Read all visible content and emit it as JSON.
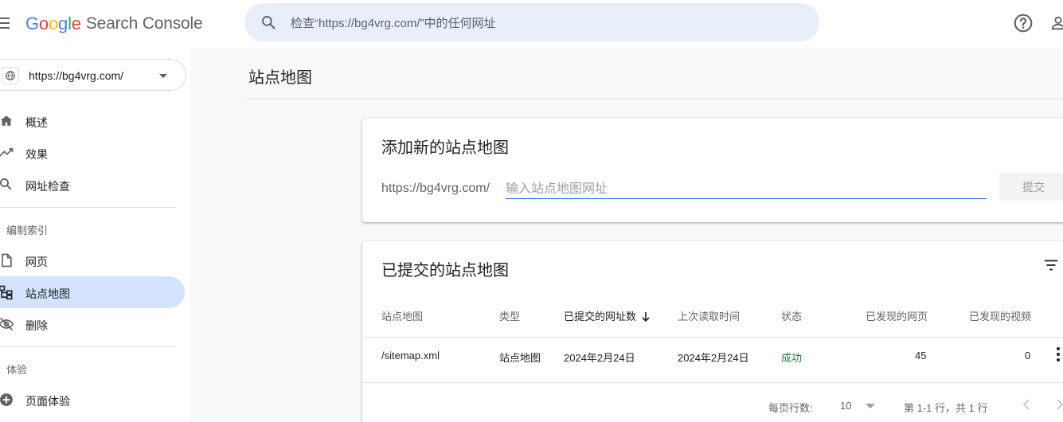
{
  "header": {
    "logo": {
      "g1": "G",
      "o1": "o",
      "o2": "o",
      "g2": "g",
      "l": "l",
      "e": "e",
      "product": "Search Console"
    },
    "search_placeholder": "检查“https://bg4vrg.com/”中的任何网址",
    "icons": {
      "menu": "menu-icon",
      "search": "search-icon",
      "help": "help-circle-icon",
      "account": "account-icon"
    }
  },
  "sidebar": {
    "property": "https://bg4vrg.com/",
    "nav_top": [
      {
        "label": "概述",
        "icon": "home-icon"
      },
      {
        "label": "效果",
        "icon": "trending-icon"
      },
      {
        "label": "网址检查",
        "icon": "search-icon"
      }
    ],
    "section_index": "编制索引",
    "nav_index": [
      {
        "label": "网页",
        "icon": "page-icon"
      },
      {
        "label": "站点地图",
        "icon": "sitemap-icon",
        "active": true
      },
      {
        "label": "删除",
        "icon": "visibility-off-icon"
      }
    ],
    "section_experience": "体验",
    "nav_experience": [
      {
        "label": "页面体验",
        "icon": "add-circle-icon"
      }
    ]
  },
  "main": {
    "page_title": "站点地图",
    "add_card": {
      "title": "添加新的站点地图",
      "url_prefix": "https://bg4vrg.com/",
      "input_placeholder": "输入站点地图网址",
      "submit_label": "提交"
    },
    "list_card": {
      "title": "已提交的站点地图",
      "columns": [
        "站点地图",
        "类型",
        "已提交的网址数",
        "上次读取时间",
        "状态",
        "已发现的网页",
        "已发现的视频"
      ],
      "rows": [
        {
          "sitemap": "/sitemap.xml",
          "type": "站点地图",
          "submitted": "2024年2月24日",
          "last_read": "2024年2月24日",
          "status": "成功",
          "pages": "45",
          "videos": "0"
        }
      ],
      "pager": {
        "rows_per_page_label": "每页行数:",
        "rows_per_page": "10",
        "range": "第 1-1 行，共 1 行"
      }
    }
  },
  "colors": {
    "accent": "#1a73e8",
    "active_nav": "#d3e3fd",
    "success": "#188038",
    "search_bg": "#e8eefa"
  }
}
